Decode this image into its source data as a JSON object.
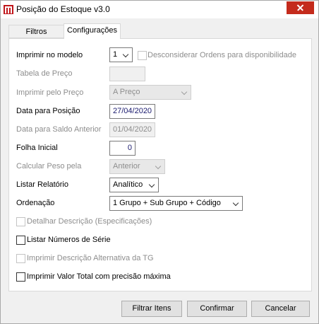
{
  "window": {
    "title": "Posição do Estoque v3.0",
    "app_icon": "app-logo-icon",
    "close_icon": "close-icon"
  },
  "tabs": [
    {
      "label": "Filtros"
    },
    {
      "label": "Configurações"
    }
  ],
  "fields": {
    "imprimir_modelo": {
      "label": "Imprimir no modelo",
      "value": "1"
    },
    "desconsiderar": {
      "label": "Desconsiderar Ordens para disponibilidade",
      "checked": false
    },
    "tabela_preco": {
      "label": "Tabela de Preço",
      "value": ""
    },
    "imprimir_preco": {
      "label": "Imprimir pelo Preço",
      "value": "A Preço"
    },
    "data_posicao": {
      "label": "Data para Posição",
      "value": "27/04/2020"
    },
    "data_saldo": {
      "label": "Data para Saldo Anterior",
      "value": "01/04/2020"
    },
    "folha_inicial": {
      "label": "Folha Inicial",
      "value": "0"
    },
    "calcular_peso": {
      "label": "Calcular Peso pela",
      "value": "Anterior"
    },
    "listar_relatorio": {
      "label": "Listar Relatório",
      "value": "Analítico"
    },
    "ordenacao": {
      "label": "Ordenação",
      "value": "1 Grupo + Sub Grupo + Código"
    }
  },
  "checkboxes": {
    "detalhar": {
      "label": "Detalhar Descrição (Especificações)",
      "checked": false
    },
    "listar_numeros": {
      "label": "Listar Números de Série",
      "checked": false
    },
    "imprimir_desc_alt": {
      "label": "Imprimir Descrição Alternativa da TG",
      "checked": false
    },
    "imprimir_valor_total": {
      "label": "Imprimir Valor Total com precisão máxima",
      "checked": false
    }
  },
  "buttons": {
    "filtrar": "Filtrar Itens",
    "confirmar": "Confirmar",
    "cancelar": "Cancelar"
  }
}
